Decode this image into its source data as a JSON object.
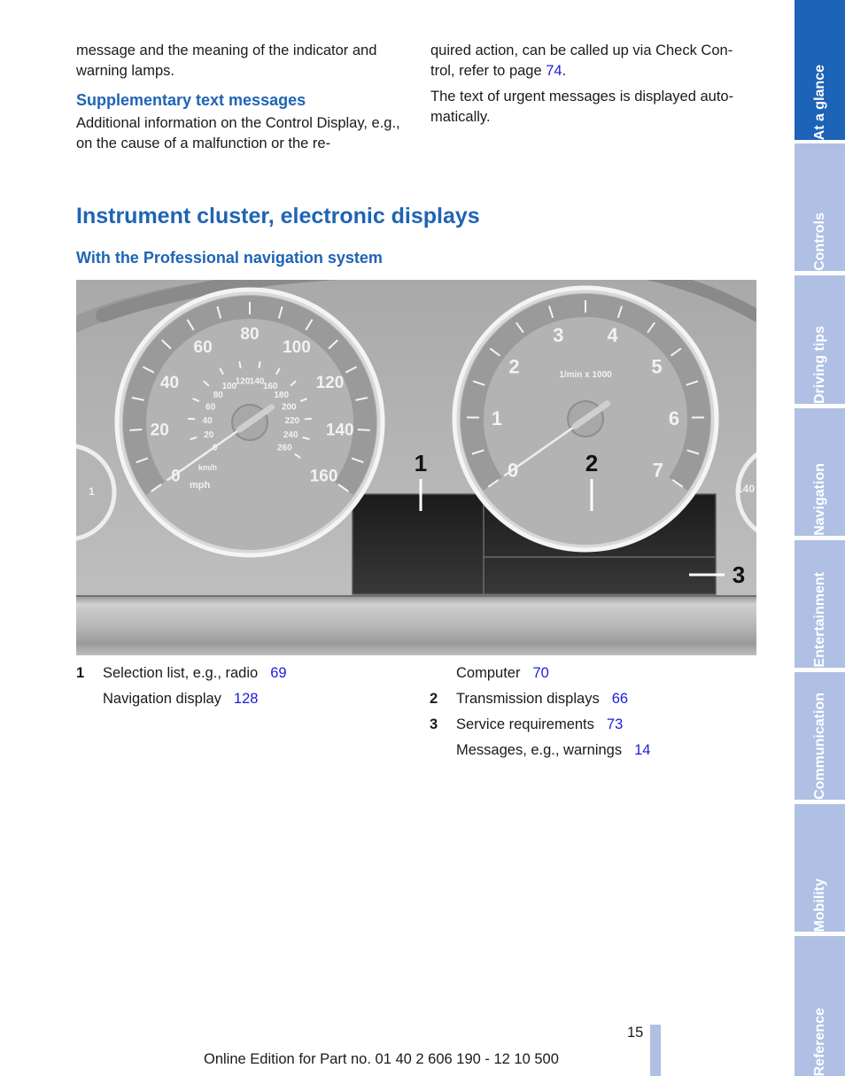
{
  "left_column": {
    "para1": "message and the meaning of the indicator and warning lamps.",
    "subheading": "Supplementary text messages",
    "para2": "Additional information on the Control Display, e.g., on the cause of a malfunction or the re-"
  },
  "right_column": {
    "para1_text": "quired action, can be called up via Check Con- trol, refer to page ",
    "para1_link": "74",
    "para1_end": ".",
    "para2": "The text of urgent messages is displayed auto- matically."
  },
  "section_title": "Instrument cluster, electronic displays",
  "section_subtitle": "With the Professional navigation system",
  "figure": {
    "callouts": [
      "1",
      "2",
      "3"
    ],
    "speedometer": {
      "mph_labels": [
        "0",
        "20",
        "40",
        "60",
        "80",
        "100",
        "120",
        "140",
        "160"
      ],
      "kmh_labels": [
        "0",
        "20",
        "40",
        "60",
        "80",
        "100",
        "120",
        "140",
        "160",
        "180",
        "200",
        "220",
        "240",
        "260"
      ],
      "unit_mph": "mph",
      "unit_kmh": "km/h"
    },
    "tachometer": {
      "labels": [
        "0",
        "1",
        "2",
        "3",
        "4",
        "5",
        "6",
        "7"
      ],
      "unit": "1/min x 1000"
    },
    "left_gauge_label": "1",
    "right_gauge_label": "140"
  },
  "legend": [
    {
      "num": "1",
      "text": "Selection list, e.g., radio",
      "page": "69"
    },
    {
      "num": "",
      "text": "Navigation display",
      "page": "128"
    },
    {
      "num": "",
      "text": "Computer",
      "page": "70"
    },
    {
      "num": "2",
      "text": "Transmission displays",
      "page": "66"
    },
    {
      "num": "3",
      "text": "Service requirements",
      "page": "73"
    },
    {
      "num": "",
      "text": "Messages, e.g., warnings",
      "page": "14"
    }
  ],
  "side_tabs": [
    {
      "label": "At a glance",
      "active": true
    },
    {
      "label": "Controls",
      "active": false
    },
    {
      "label": "Driving tips",
      "active": false
    },
    {
      "label": "Navigation",
      "active": false
    },
    {
      "label": "Entertainment",
      "active": false
    },
    {
      "label": "Communication",
      "active": false
    },
    {
      "label": "Mobility",
      "active": false
    },
    {
      "label": "Reference",
      "active": false
    }
  ],
  "page_number": "15",
  "footer": "Online Edition for Part no. 01 40 2 606 190 - 12 10 500",
  "colors": {
    "heading": "#1f64b4",
    "link": "#1c1cdc",
    "tab_active": "#1d63b7",
    "tab_inactive": "#b0c0e4"
  }
}
